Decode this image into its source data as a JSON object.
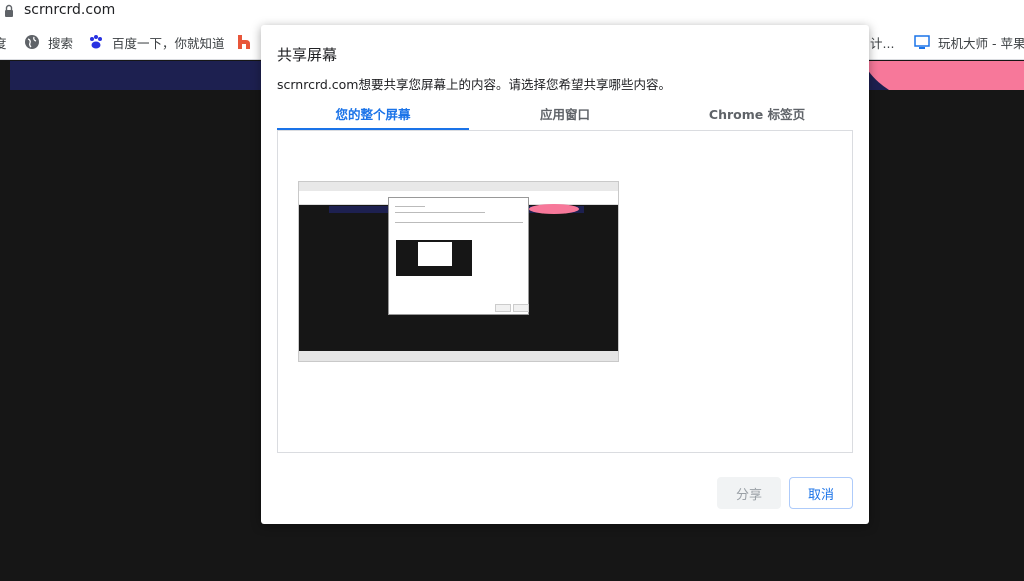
{
  "browser": {
    "url": "scrnrcrd.com",
    "bookmarks": [
      {
        "label": "度",
        "icon": "partial-icon"
      },
      {
        "label": "搜索",
        "icon": "globe-icon"
      },
      {
        "label": "百度一下，你就知道",
        "icon": "baidu-paw-icon"
      },
      {
        "label": "",
        "icon": "h-logo-icon"
      },
      {
        "label": "计...",
        "icon": "none"
      },
      {
        "label": "玩机大师 - 苹果",
        "icon": "monitor-icon"
      }
    ]
  },
  "dialog": {
    "title": "共享屏幕",
    "message": "scrnrcrd.com想要共享您屏幕上的内容。请选择您希望共享哪些内容。",
    "tabs": [
      {
        "label": "您的整个屏幕",
        "active": true
      },
      {
        "label": "应用窗口",
        "active": false
      },
      {
        "label": "Chrome 标签页",
        "active": false
      }
    ],
    "share_label": "分享",
    "cancel_label": "取消"
  },
  "colors": {
    "accent": "#1a73e8",
    "backdrop": "#161616",
    "banner": "#1d2050",
    "pink": "#f7789a"
  }
}
